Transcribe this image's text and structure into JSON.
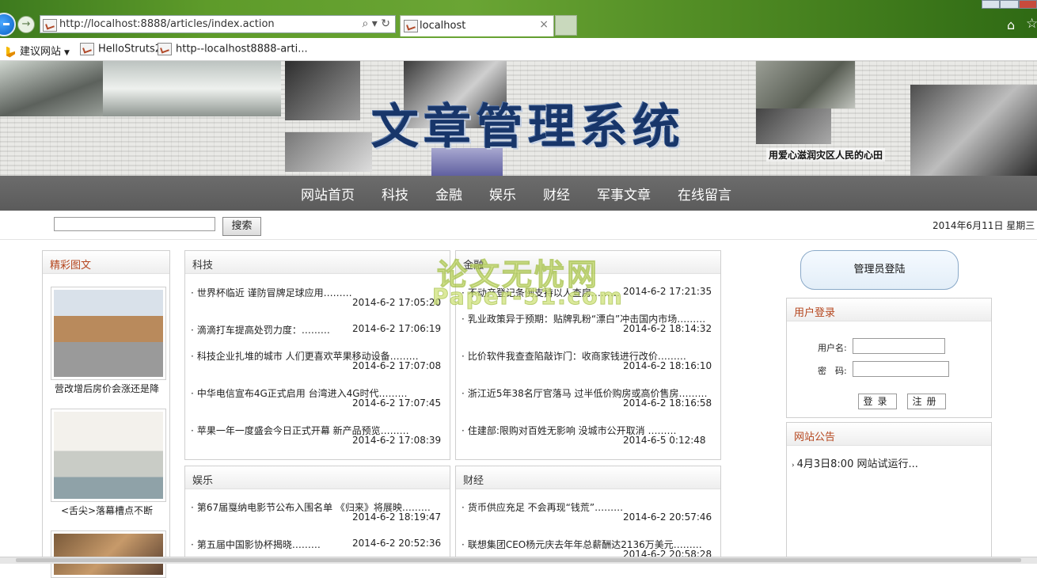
{
  "browser": {
    "url": "http://localhost:8888/articles/index.action",
    "tab_title": "localhost",
    "tab_close": "×",
    "favorites": [
      "建议网站",
      "HelloStruts2",
      "http--localhost8888-arti..."
    ]
  },
  "banner": {
    "title": "文章管理系统",
    "caption": "用爱心滋润灾区人民的心田"
  },
  "nav": {
    "items": [
      "网站首页",
      "科技",
      "金融",
      "娱乐",
      "财经",
      "军事文章",
      "在线留言"
    ]
  },
  "search": {
    "button_label": "搜索",
    "value": ""
  },
  "date_text": "2014年6月11日 星期三",
  "left": {
    "title": "精彩图文",
    "captions": [
      "营改增后房价会涨还是降",
      "<舌尖>落幕槽点不断"
    ]
  },
  "sections": [
    {
      "title": "科技",
      "items": [
        {
          "title": "世界杯临近 谨防冒牌足球应用………",
          "date": "2014-6-2 17:05:20"
        },
        {
          "title": "滴滴打车提高处罚力度：………",
          "date": "2014-6-2 17:06:19"
        },
        {
          "title": "科技企业扎堆的城市 人们更喜欢苹果移动设备………",
          "date": "2014-6-2 17:07:08"
        },
        {
          "title": "中华电信宣布4G正式启用 台湾进入4G时代………",
          "date": "2014-6-2 17:07:45"
        },
        {
          "title": "苹果一年一度盛会今日正式开幕 新产品预览………",
          "date": "2014-6-2 17:08:39"
        }
      ]
    },
    {
      "title": "金融",
      "items": [
        {
          "title": "不动产登记条例支持以人查房………",
          "date": "2014-6-2 17:21:35"
        },
        {
          "title": "乳业政策异于预期：贴牌乳粉“漂白”冲击国内市场………",
          "date": "2014-6-2 18:14:32"
        },
        {
          "title": "比价软件我查查陷敲诈门：收商家钱进行改价………",
          "date": "2014-6-2 18:16:10"
        },
        {
          "title": "浙江近5年38名厅官落马 过半低价购房或高价售房………",
          "date": "2014-6-2 18:16:58"
        },
        {
          "title": "住建部:限购对百姓无影响 没城市公开取消 ………",
          "date": "2014-6-5 0:12:48"
        }
      ]
    },
    {
      "title": "娱乐",
      "items": [
        {
          "title": "第67届戛纳电影节公布入围名单 《归来》将展映………",
          "date": "2014-6-2 18:19:47"
        },
        {
          "title": "第五届中国影协杯揭晓………",
          "date": "2014-6-2 20:52:36"
        }
      ]
    },
    {
      "title": "财经",
      "items": [
        {
          "title": "货币供应充足 不会再现“钱荒”………",
          "date": "2014-6-2 20:57:46"
        },
        {
          "title": "联想集团CEO杨元庆去年年总薪酬达2136万美元………",
          "date": "2014-6-2 20:58:28"
        }
      ]
    }
  ],
  "right": {
    "admin_label": "管理员登陆",
    "login_title": "用户登录",
    "username_label": "用户名:",
    "password_label": "密　码:",
    "login_btn": "登录",
    "register_btn": "注册",
    "notice_title": "网站公告",
    "notice_items": [
      "4月3日8:00 网站试运行..."
    ]
  },
  "watermark": {
    "line1": "论文无忧网",
    "line2": "Paper-51.com"
  }
}
